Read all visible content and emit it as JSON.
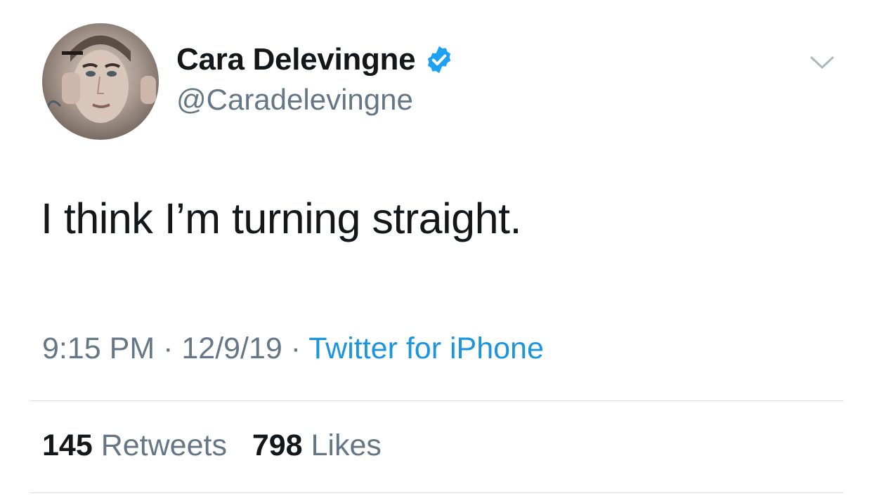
{
  "author": {
    "display_name": "Cara Delevingne",
    "handle": "@Caradelevingne",
    "verified": true,
    "avatar_icon": "profile-photo"
  },
  "tweet": {
    "text": "I think I’m turning straight.",
    "time": "9:15 PM",
    "date": "12/9/19",
    "separator": " · ",
    "source": "Twitter for iPhone"
  },
  "stats": {
    "retweets_count": "145",
    "retweets_label": "Retweets",
    "likes_count": "798",
    "likes_label": "Likes"
  },
  "colors": {
    "text": "#14171a",
    "secondary": "#657786",
    "link": "#1b95e0",
    "verified_badge": "#1da1f2",
    "divider": "#d9dde2"
  },
  "icons": {
    "verified": "verified-badge-icon",
    "menu": "chevron-down-icon"
  }
}
